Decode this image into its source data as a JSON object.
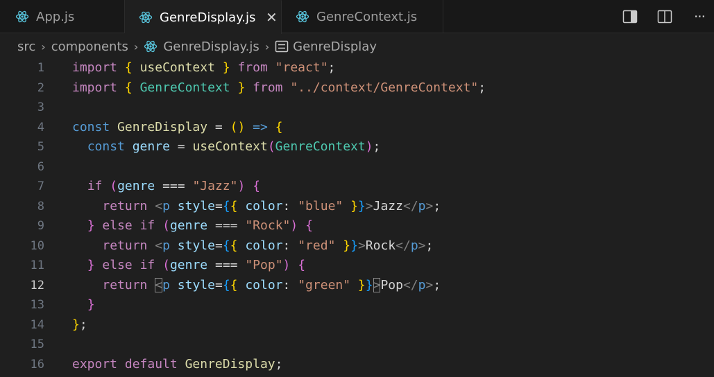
{
  "tabs": [
    {
      "label": "App.js",
      "icon": "react-icon",
      "active": false
    },
    {
      "label": "GenreDisplay.js",
      "icon": "react-icon",
      "active": true
    },
    {
      "label": "GenreContext.js",
      "icon": "react-icon",
      "active": false
    }
  ],
  "tab_close_glyph": "✕",
  "actions": [
    "toggle-panel-icon",
    "split-editor-icon",
    "more-actions-icon"
  ],
  "more_glyph": "···",
  "breadcrumb": {
    "items": [
      "src",
      "components",
      "GenreDisplay.js",
      "GenreDisplay"
    ],
    "separator": "›"
  },
  "current_line": 12,
  "line_numbers": [
    "1",
    "2",
    "3",
    "4",
    "5",
    "6",
    "7",
    "8",
    "9",
    "10",
    "11",
    "12",
    "13",
    "14",
    "15",
    "16"
  ],
  "code_lines": [
    "import { useContext } from \"react\";",
    "import { GenreContext } from \"../context/GenreContext\";",
    "",
    "const GenreDisplay = () => {",
    "  const genre = useContext(GenreContext);",
    "",
    "  if (genre === \"Jazz\") {",
    "    return <p style={{ color: \"blue\" }}>Jazz</p>;",
    "  } else if (genre === \"Rock\") {",
    "    return <p style={{ color: \"red\" }}>Rock</p>;",
    "  } else if (genre === \"Pop\") {",
    "    return <p style={{ color: \"green\" }}>Pop</p>;",
    "  }",
    "};",
    "",
    "export default GenreDisplay;"
  ],
  "colors": {
    "editor_bg": "#1f1f1f",
    "tabbar_bg": "#181818",
    "keyword": "#569cd6",
    "control": "#c586c0",
    "function": "#dcdcaa",
    "string": "#ce9178",
    "variable": "#9cdcfe",
    "react": "#58c4dc"
  }
}
